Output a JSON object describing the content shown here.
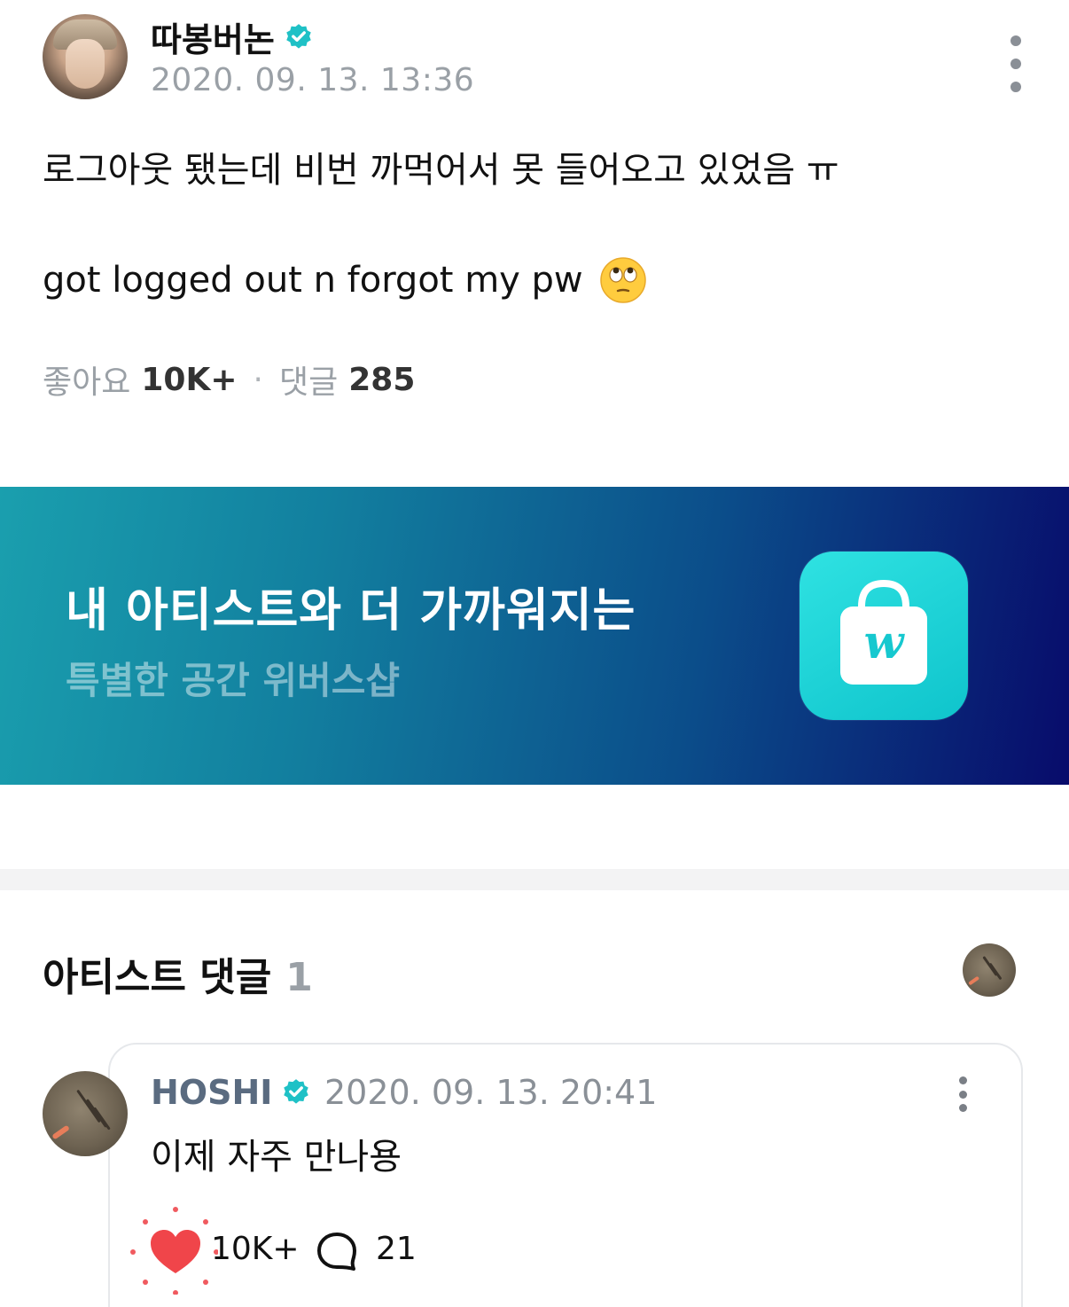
{
  "post": {
    "author": "따봉버논",
    "timestamp": "2020. 09. 13. 13:36",
    "body_korean": "로그아웃 됐는데 비번 까먹어서 못 들어오고 있었음 ㅠ",
    "body_english": "got logged out n forgot my pw",
    "stats": {
      "likes_label": "좋아요",
      "likes_value": "10K+",
      "separator": "·",
      "comments_label": "댓글",
      "comments_value": "285"
    }
  },
  "banner": {
    "title": "내 아티스트와 더 가까워지는",
    "subtitle": "특별한 공간 위버스샵",
    "icon_letter": "w"
  },
  "artist_comments": {
    "title": "아티스트 댓글",
    "count": "1",
    "comment": {
      "author": "HOSHI",
      "timestamp": "2020. 09. 13. 20:41",
      "text": "이제 자주 만나용",
      "likes": "10K+",
      "replies": "21"
    }
  },
  "colors": {
    "verified": "#1fc1c6",
    "banner_start": "#1a9fae",
    "banner_end": "#080b6b",
    "shop_icon": "#1fd0d6",
    "heart": "#f0454a",
    "muted_text": "#9aa0a6"
  },
  "icons": {
    "verified": "verified-badge-icon",
    "more": "more-vertical-icon",
    "emoji": "face-with-rolling-eyes-emoji",
    "shop": "weverse-shop-bag-icon",
    "like": "heart-icon",
    "reply": "speech-bubble-icon"
  }
}
